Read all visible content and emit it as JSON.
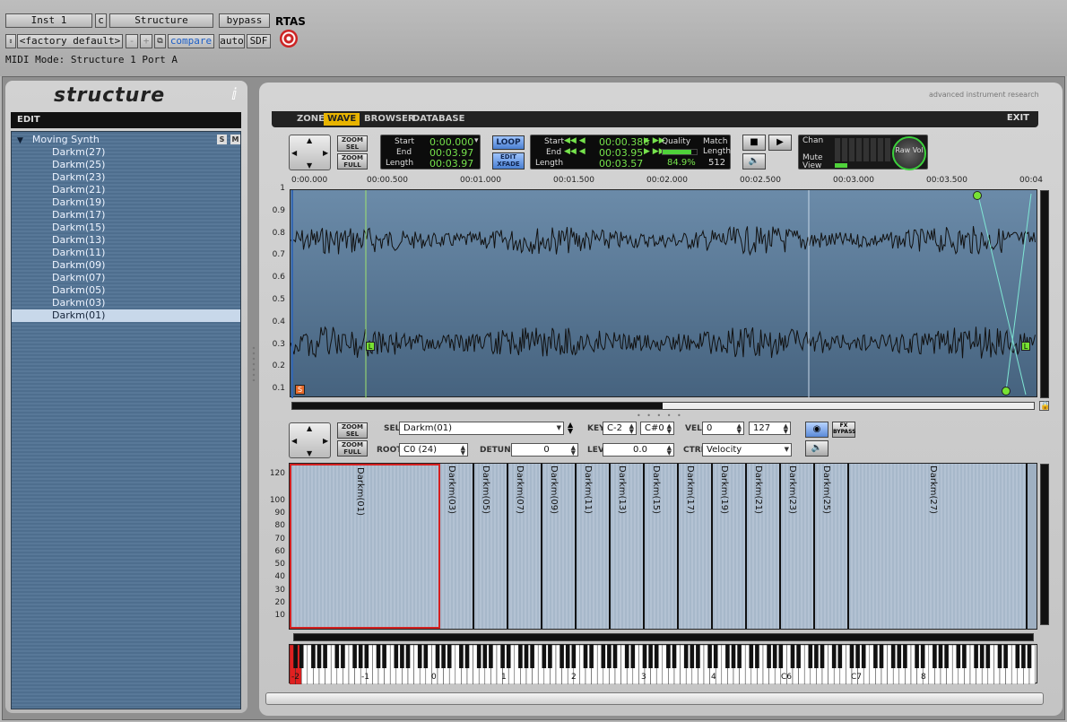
{
  "host": {
    "track": "Inst 1",
    "insert_slot": "c",
    "plugin_name": "Structure",
    "bypass": "bypass",
    "format": "RTAS",
    "preset": "<factory default>",
    "minus": "-",
    "plus": "+",
    "compare": "compare",
    "auto": "auto",
    "sdf": "SDF",
    "midi_mode": "MIDI Mode: Structure 1 Port A"
  },
  "logo": "structure",
  "brand": "advanced instrument research",
  "sidebar": {
    "header": "EDIT",
    "root": "Moving Synth",
    "solo": "S",
    "mute": "M",
    "items": [
      "Darkm(27)",
      "Darkm(25)",
      "Darkm(23)",
      "Darkm(21)",
      "Darkm(19)",
      "Darkm(17)",
      "Darkm(15)",
      "Darkm(13)",
      "Darkm(11)",
      "Darkm(09)",
      "Darkm(07)",
      "Darkm(05)",
      "Darkm(03)",
      "Darkm(01)"
    ],
    "selected_index": 13
  },
  "tabs": [
    {
      "label": "ZONE"
    },
    {
      "label": "WAVE"
    },
    {
      "label": "BROWSER"
    },
    {
      "label": "DATABASE"
    }
  ],
  "active_tab": "WAVE",
  "exit": "EXIT",
  "zoom": {
    "sel": "ZOOM SEL",
    "full": "ZOOM FULL"
  },
  "sample_display": {
    "start_label": "Start",
    "start": "0:00.000",
    "end_label": "End",
    "end": "00:03.97",
    "length_label": "Length",
    "length": "00:03.97"
  },
  "loop": {
    "loop_btn": "LOOP",
    "edit_xfade": "EDIT XFADE",
    "start_label": "Start",
    "start": "00:00.386",
    "end_label": "End",
    "end": "00:03.95",
    "length_label": "Length",
    "length": "00:03.57",
    "quality_label": "Quality",
    "quality": "84.9%",
    "match_label": "Match Length",
    "match": "512"
  },
  "meter": {
    "chan": "Chan",
    "mute": "Mute",
    "view": "View",
    "knob": "Raw Vol"
  },
  "ruler": [
    "0:00.000",
    "00:00.500",
    "00:01.000",
    "00:01.500",
    "00:02.000",
    "00:02.500",
    "00:03.000",
    "00:03.500",
    "00:04"
  ],
  "wave_y": [
    "1",
    "0.9",
    "0.8",
    "0.7",
    "0.6",
    "0.5",
    "0.4",
    "0.3",
    "0.2",
    "0.1"
  ],
  "markers": {
    "start": "S",
    "loop_left": "L",
    "loop_right": "L"
  },
  "zone_ctrl": {
    "sel_label": "SEL",
    "sel": "Darkm(01)",
    "key_label": "KEY",
    "key_low": "C-2",
    "key_high": "C#0",
    "vel_label": "VEL",
    "vel_low": "0",
    "vel_high": "127",
    "root_label": "ROOT",
    "root": "C0 (24)",
    "detune_label": "DETUNE",
    "detune": "0",
    "lev_label": "LEV",
    "lev": "0.0",
    "ctrl_label": "CTRL",
    "ctrl": "Velocity",
    "fx_bypass": "FX BYPASS"
  },
  "map_y": [
    "120",
    "100",
    "90",
    "80",
    "70",
    "60",
    "50",
    "40",
    "30",
    "20",
    "10"
  ],
  "zones": [
    "Darkm(01)",
    "Darkm(03)",
    "Darkm(05)",
    "Darkm(07)",
    "Darkm(09)",
    "Darkm(11)",
    "Darkm(13)",
    "Darkm(15)",
    "Darkm(17)",
    "Darkm(19)",
    "Darkm(21)",
    "Darkm(23)",
    "Darkm(25)",
    "Darkm(27)"
  ],
  "octaves": [
    "-2",
    "-1",
    "0",
    "1",
    "2",
    "3",
    "4",
    "C6",
    "C7",
    "8"
  ]
}
